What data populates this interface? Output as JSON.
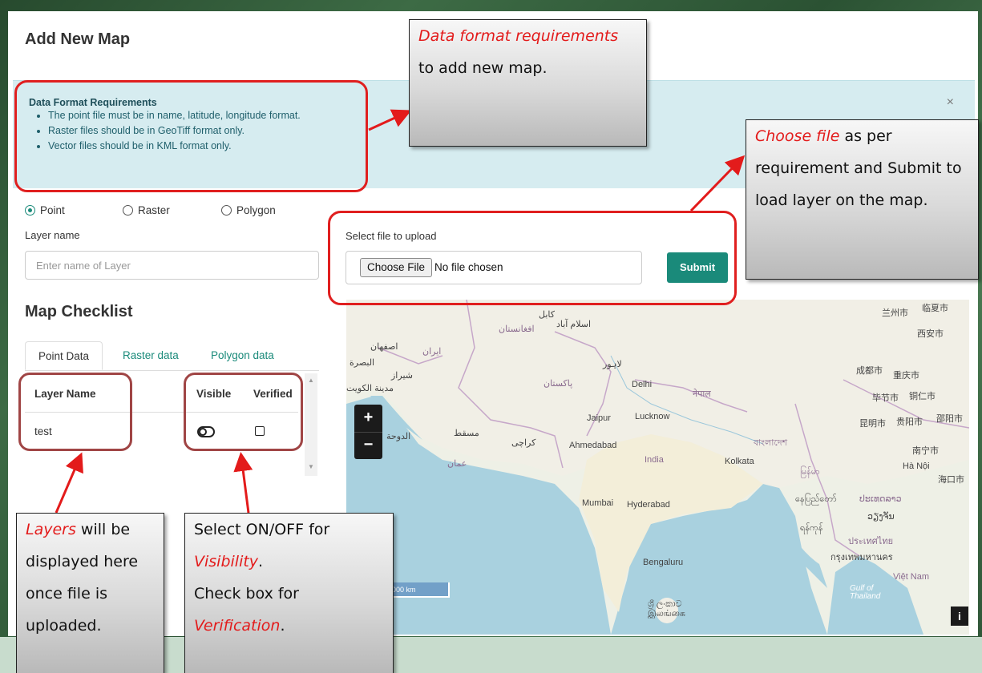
{
  "page": {
    "title": "Add New Map"
  },
  "alert": {
    "title": "Data Format Requirements",
    "items": [
      "The point file must be in name, latitude, longitude format.",
      "Raster files should be in GeoTiff format only.",
      "Vector files should be in KML format only."
    ],
    "close": "×"
  },
  "layer_type": {
    "options": [
      "Point",
      "Raster",
      "Polygon"
    ],
    "selected": "Point"
  },
  "layer_name": {
    "label": "Layer name",
    "placeholder": "Enter name of Layer"
  },
  "upload": {
    "label": "Select file to upload",
    "choose_button": "Choose File",
    "status": "No file chosen",
    "submit": "Submit"
  },
  "checklist": {
    "title": "Map Checklist",
    "tabs": [
      "Point Data",
      "Raster data",
      "Polygon data"
    ],
    "active_tab": "Point Data",
    "columns": [
      "Layer Name",
      "Visible",
      "Verified"
    ],
    "rows": [
      {
        "name": "test",
        "visible": false,
        "verified": false
      }
    ]
  },
  "map": {
    "zoom_in": "+",
    "zoom_out": "−",
    "info": "i",
    "scale": "000 km",
    "labels": {
      "kabul": "کابل",
      "islamabad": "اسلام آباد",
      "afghanistan": "افغانستان",
      "isfahan": "اصفهان",
      "iran": "ایران",
      "lahore": "لاہور",
      "basra": "البصرة",
      "shiraz": "شیراز",
      "kuwait": "مدينة الكويت",
      "pakistan": "پاکستان",
      "delhi": "Delhi",
      "nepal": "नेपाल",
      "jaipur": "Jaipur",
      "lucknow": "Lucknow",
      "doha": "الدوحة",
      "muscat": "مسقط",
      "karachi": "کراچی",
      "ahmedabad": "Ahmedabad",
      "bangladesh": "বাংলাদেশ",
      "oman": "عمان",
      "india": "India",
      "kolkata": "Kolkata",
      "myanmar": "မြန်မာ",
      "mumbai": "Mumbai",
      "hyderabad": "Hyderabad",
      "naypyidaw": "နေပြည်တော်",
      "yangon": "ရန်ကုန်",
      "bengaluru": "Bengaluru",
      "srilanka": "ශ්‍රී ලංකාව இலங்கை",
      "lanzhou": "兰州市",
      "linxia": "临夏市",
      "xian": "西安市",
      "chengdu": "成都市",
      "chongqing": "重庆市",
      "bijie": "毕节市",
      "tongren": "铜仁市",
      "kunming": "昆明市",
      "guiyang": "贵阳市",
      "shaoyang": "邵阳市",
      "nanning": "南宁市",
      "hanoi": "Hà Nội",
      "haikou": "海口市",
      "laos": "ປະເທດລາວ",
      "thailand_th": "ประเทศไทย",
      "bangkok": "กรุงเทพมหานคร",
      "vietnam": "Việt Nam",
      "gulf": "Gulf of Thailand",
      "vientiane": "ວຽງຈັນ"
    }
  },
  "callouts": {
    "format": {
      "em": "Data format requirements",
      "rest": " to add new map."
    },
    "choose": {
      "em": "Choose file",
      "rest": " as per requirement and Submit to load layer on the map."
    },
    "layers": {
      "em": "Layers",
      "rest": " will be displayed here once file is uploaded."
    },
    "visibility": {
      "line1": "Select ON/OFF for",
      "em1": "Visibility",
      "dot1": ".",
      "line3": "Check box for",
      "em2": "Verification",
      "dot2": "."
    }
  },
  "colors": {
    "accent": "#1a8a7a",
    "annotation_red": "#e01f1f",
    "alert_bg": "#d6ecf0"
  }
}
